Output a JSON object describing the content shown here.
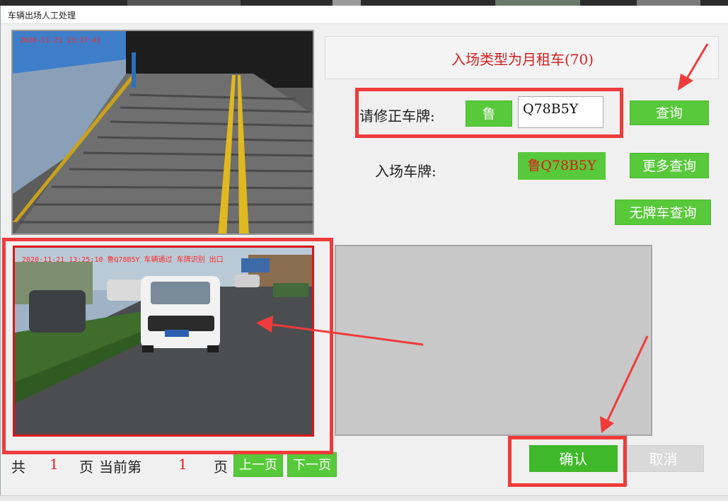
{
  "window": {
    "title": "车辆出场人工处理"
  },
  "cameras": {
    "top_timestamp": "2020-11-21 13:37:41",
    "bottom_timestamp": "2020-11-21 13:25:10 鲁Q78B5Y 车辆通过 车牌识别 出口"
  },
  "info": {
    "message": "入场类型为月租车(70)"
  },
  "correct_plate": {
    "label": "请修正车牌:",
    "province_button": "鲁",
    "plate_value": "Q78B5Y",
    "query_button": "查询"
  },
  "entry_plate": {
    "label": "入场车牌:",
    "value": "鲁Q78B5Y",
    "more_query_button": "更多查询"
  },
  "no_plate_query_button": "无牌车查询",
  "pager": {
    "total_prefix": "共",
    "total_pages": "1",
    "total_suffix": "页",
    "current_prefix": "当前第",
    "current_page": "1",
    "current_suffix": "页",
    "prev_button": "上一页",
    "next_button": "下一页"
  },
  "actions": {
    "confirm_button": "确认",
    "cancel_button": "取消"
  },
  "colors": {
    "accent_green": "#57c93a",
    "alert_red": "#ef3b3b",
    "message_red": "#d42020"
  }
}
